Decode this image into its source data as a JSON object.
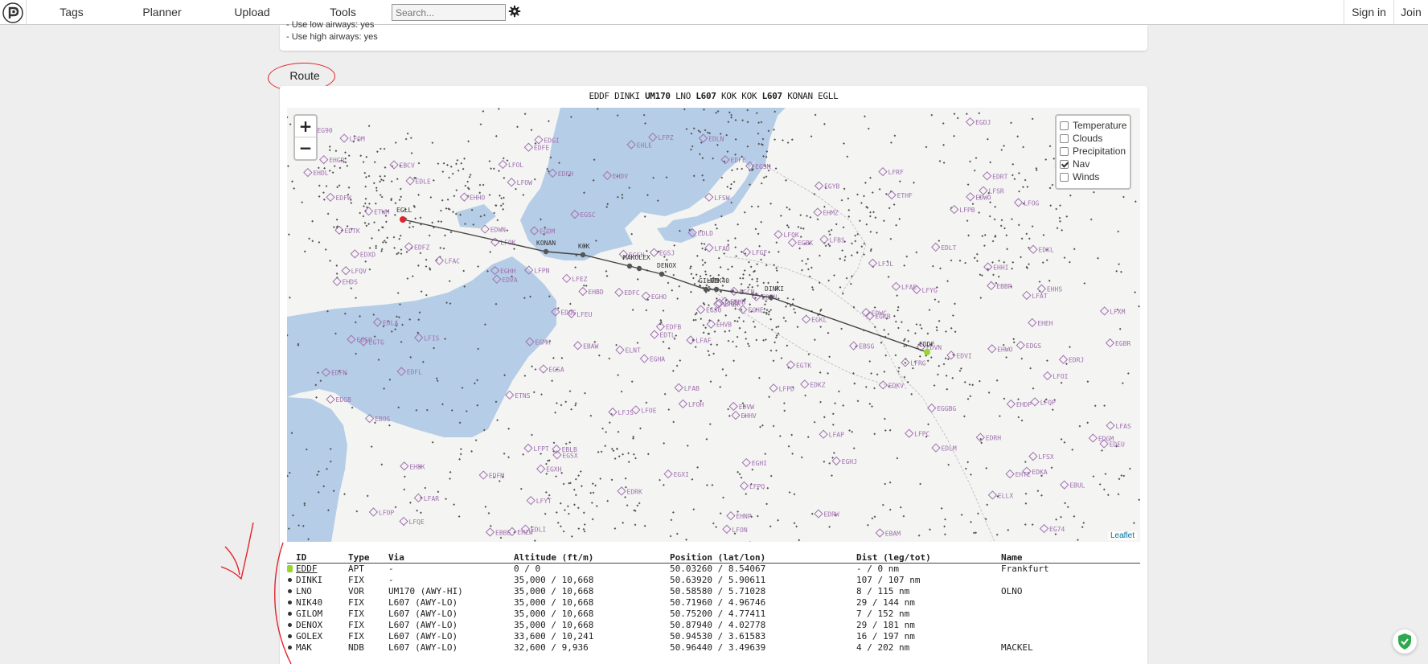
{
  "nav": {
    "tags": "Tags",
    "planner": "Planner",
    "upload": "Upload",
    "tools": "Tools",
    "search_placeholder": "Search...",
    "sign_in": "Sign in",
    "join": "Join"
  },
  "options": {
    "low_airways": "- Use low airways: yes",
    "high_airways": "- Use high airways: yes"
  },
  "route_tab": "Route",
  "route_string": [
    {
      "text": "EDDF",
      "bold": false
    },
    {
      "text": "DINKI",
      "bold": false
    },
    {
      "text": "UM170",
      "bold": true
    },
    {
      "text": "LNO",
      "bold": false
    },
    {
      "text": "L607",
      "bold": true
    },
    {
      "text": "KOK",
      "bold": false
    },
    {
      "text": "KOK",
      "bold": false
    },
    {
      "text": "L607",
      "bold": true
    },
    {
      "text": "KONAN",
      "bold": false
    },
    {
      "text": "EGLL",
      "bold": false
    }
  ],
  "map": {
    "zoom_in": "+",
    "zoom_out": "−",
    "layers": [
      {
        "label": "Temperature",
        "checked": false
      },
      {
        "label": "Clouds",
        "checked": false
      },
      {
        "label": "Precipitation",
        "checked": false
      },
      {
        "label": "Nav",
        "checked": true
      },
      {
        "label": "Winds",
        "checked": false
      }
    ],
    "attribution": "Leaflet",
    "route_labels": [
      "EGLL",
      "KONAN",
      "KOK",
      "MAKOLEX",
      "DENOX",
      "GILOM",
      "NIK40",
      "DINKI",
      "EDDF"
    ],
    "airport_labels": [
      "EGXI",
      "EGTG",
      "EGSA",
      "EGSJ",
      "EGSM",
      "EGGBG",
      "EG74",
      "EG30",
      "EGBR",
      "EGSC",
      "EGSH",
      "EGXH",
      "EGSO",
      "EGYB",
      "EG90",
      "EGBK",
      "EGCN",
      "EGSX",
      "EGMH",
      "EGKB",
      "EGKL",
      "EGDJ",
      "EGHO",
      "EGDM",
      "EGHA",
      "EGHI",
      "EGHH",
      "EGHE",
      "EGHJ",
      "EGTK",
      "LFAC",
      "LFIS",
      "LFON",
      "LFAT",
      "LFOI",
      "LFOE",
      "LFAE",
      "LFAB",
      "LFOP",
      "LFPD",
      "LFOH",
      "LFRG",
      "LFOM",
      "LFRF",
      "LFAS",
      "LFOG",
      "LFPA",
      "LFOL",
      "EBOS",
      "EBFN",
      "EBUL",
      "EBAM",
      "EBCV",
      "EBSG",
      "EBLB",
      "EBBR",
      "EBBE",
      "EBMB",
      "EBAW",
      "EHZW",
      "EHWO",
      "EHMZ",
      "EHHS",
      "EHDP",
      "EHEH",
      "EHBK",
      "EHVK",
      "EHGR",
      "EHVB",
      "EHBD",
      "EHHI",
      "EHDL",
      "EHHV",
      "EHTE",
      "EHLE",
      "EHNP",
      "EHDV",
      "EHHO",
      "EHDS",
      "EDWN",
      "EDWC",
      "ETWM",
      "ETNS",
      "EDXD",
      "EDWO",
      "EDKA",
      "EDLN",
      "EDLM",
      "EDLD",
      "EDLA",
      "EDLE",
      "EDKV",
      "EDKZ",
      "EDKL",
      "EDFN",
      "EDFM",
      "EDGS",
      "EDGB",
      "EDRW",
      "EDRK",
      "EDFH",
      "EDFE",
      "EDFC",
      "EDRH",
      "EDRT",
      "EDFZ",
      "EDRJ",
      "EDQG",
      "EDEU",
      "EDVW",
      "EDVI",
      "EDVN",
      "EDVA",
      "ETHF",
      "EDLI",
      "EDLT",
      "EDFL",
      "EDFB",
      "EDFW",
      "EDFE",
      "EDTL",
      "EDGM",
      "EDGI",
      "EDTK",
      "ELLX",
      "ELNT",
      "LFQV",
      "LFSX",
      "LFJL",
      "LFQA",
      "LFQP",
      "LFXM",
      "LFSW",
      "LFQK",
      "LFEU",
      "LFEZ",
      "LFGF",
      "LFBS",
      "LFPB",
      "LFPN",
      "LFPC",
      "LFPT",
      "LFPZ",
      "LFOK",
      "LFPQ",
      "LFYG",
      "LFYT",
      "LFOW",
      "LFAR",
      "LFAF",
      "LFAP",
      "LFAD",
      "LFJS",
      "LFSR",
      "LFQE",
      "LFOR"
    ]
  },
  "table": {
    "headers": [
      "ID",
      "Type",
      "Via",
      "Altitude (ft/m)",
      "Position (lat/lon)",
      "Dist (leg/tot)",
      "Name"
    ],
    "rows": [
      [
        "EDDF",
        "APT",
        "-",
        "0 / 0",
        "50.03260 / 8.54067",
        "- / 0 nm",
        "Frankfurt"
      ],
      [
        "DINKI",
        "FIX",
        "-",
        "35,000 / 10,668",
        "50.63920 / 5.90611",
        "107 / 107 nm",
        ""
      ],
      [
        "LNO",
        "VOR",
        "UM170 (AWY-HI)",
        "35,000 / 10,668",
        "50.58580 / 5.71028",
        "8 / 115 nm",
        "OLNO"
      ],
      [
        "NIK40",
        "FIX",
        "L607 (AWY-LO)",
        "35,000 / 10,668",
        "50.71960 / 4.96746",
        "29 / 144 nm",
        ""
      ],
      [
        "GILOM",
        "FIX",
        "L607 (AWY-LO)",
        "35,000 / 10,668",
        "50.75200 / 4.77411",
        "7 / 152 nm",
        ""
      ],
      [
        "DENOX",
        "FIX",
        "L607 (AWY-LO)",
        "35,000 / 10,668",
        "50.87940 / 4.02778",
        "29 / 181 nm",
        ""
      ],
      [
        "GOLEX",
        "FIX",
        "L607 (AWY-LO)",
        "33,600 / 10,241",
        "50.94530 / 3.61583",
        "16 / 197 nm",
        ""
      ],
      [
        "MAK",
        "NDB",
        "L607 (AWY-LO)",
        "32,600 / 9,936",
        "50.96440 / 3.49639",
        "4 / 202 nm",
        "MACKEL"
      ]
    ]
  },
  "colors": {
    "water": "#b5cde6",
    "land": "#f4f4f2",
    "airport_marker": "#a070b0",
    "route_line": "#444444",
    "origin_marker": "#9ad42e",
    "dest_marker": "#e3232c",
    "annotation": "#e3232c"
  }
}
